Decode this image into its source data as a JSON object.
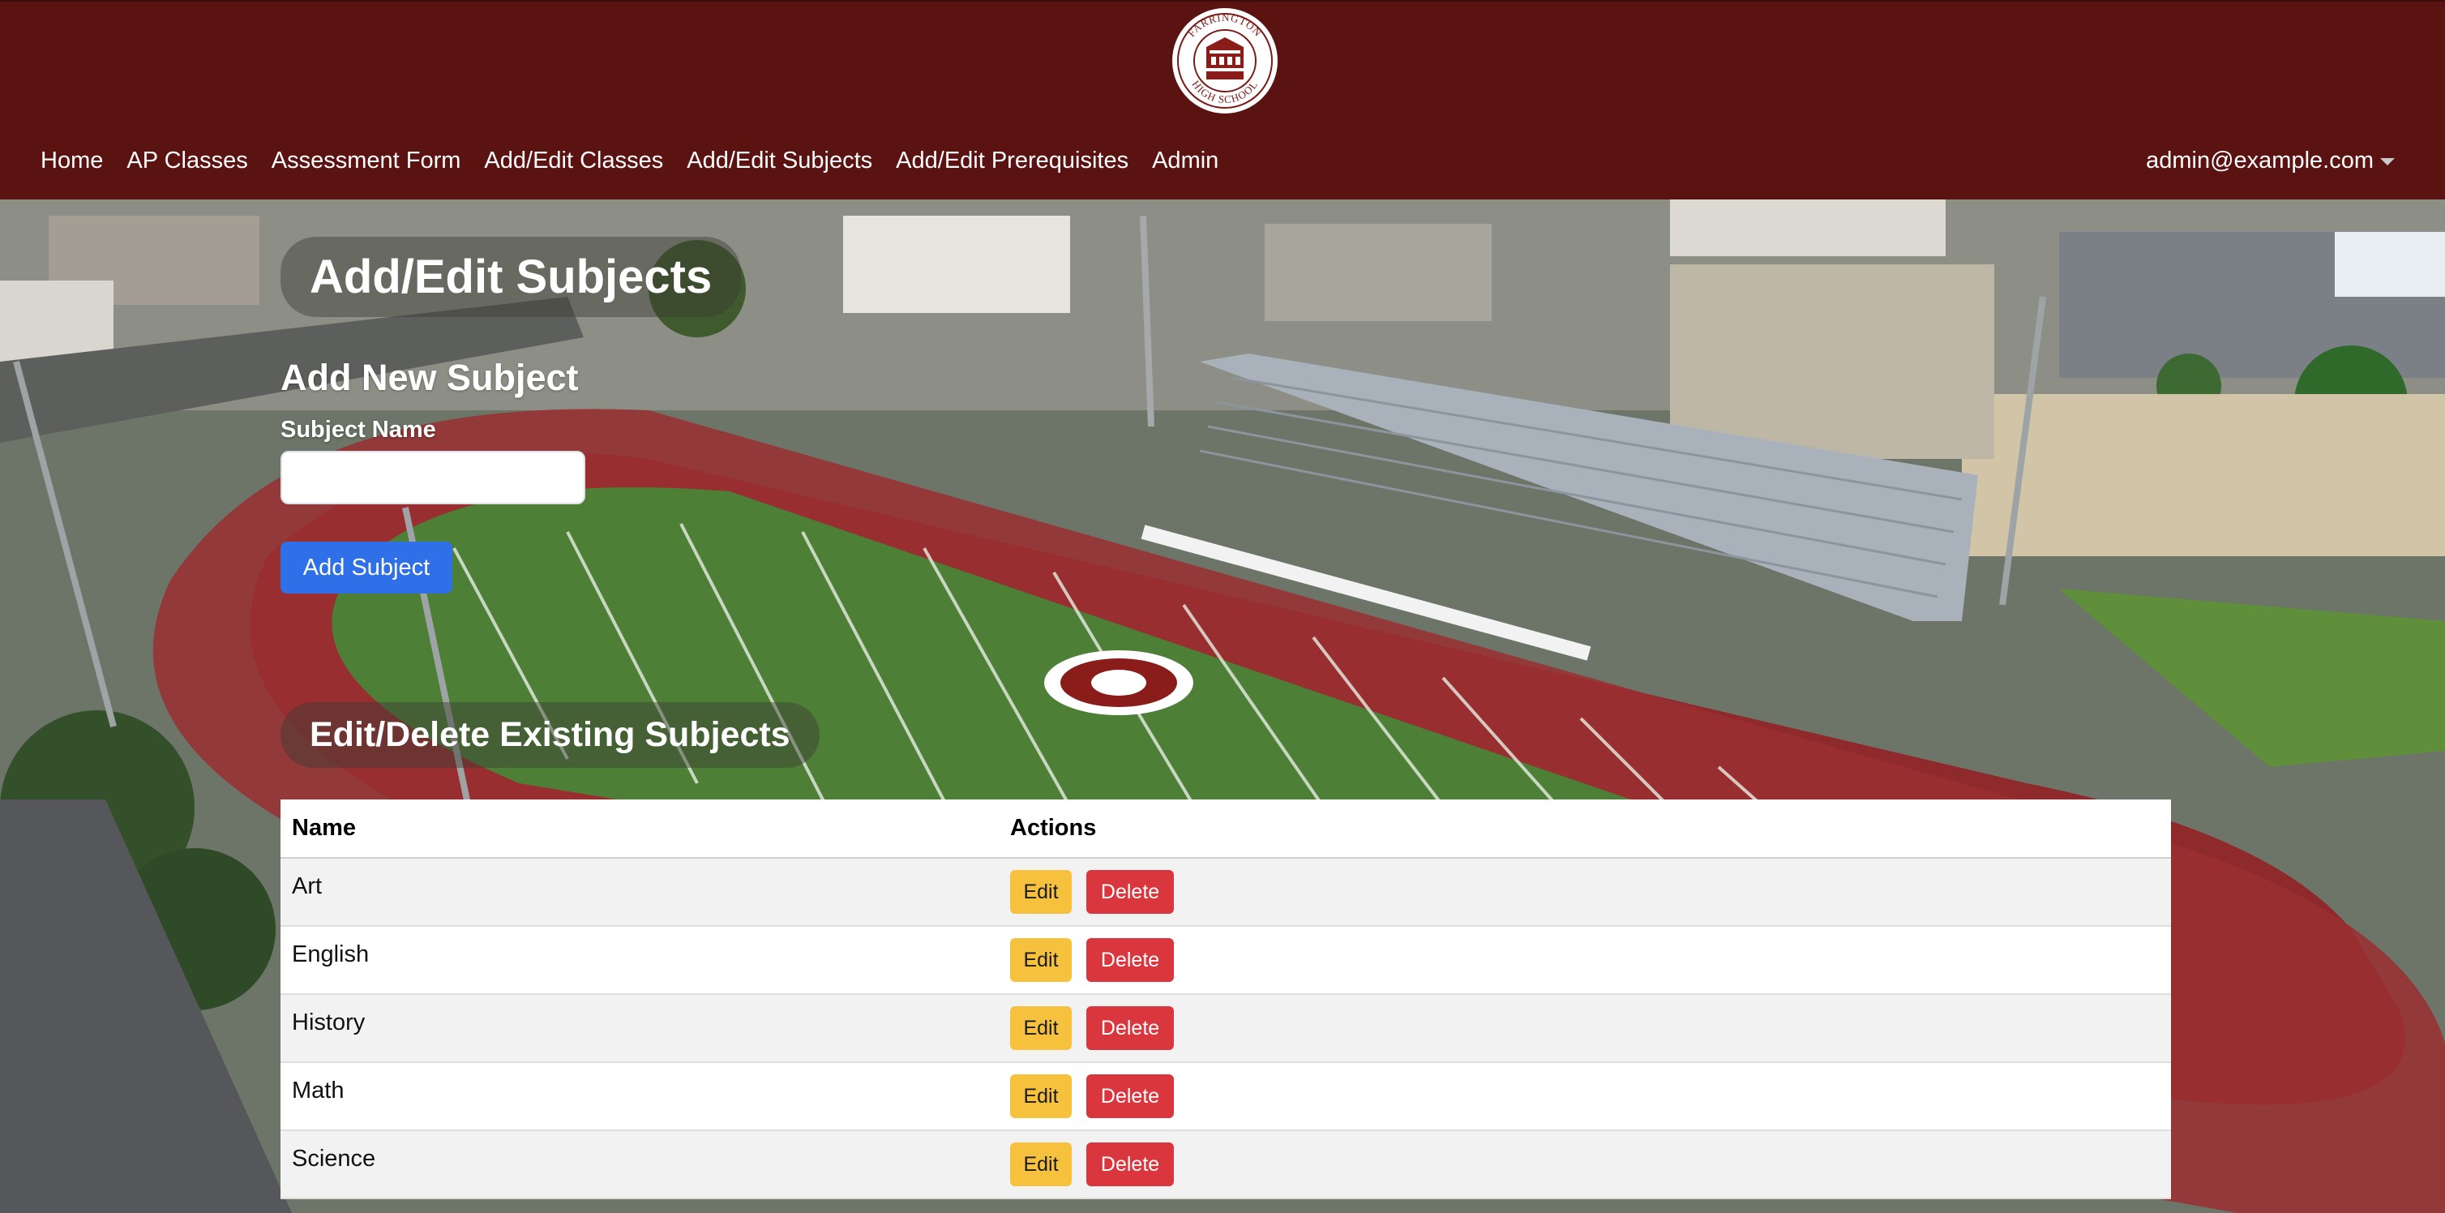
{
  "header": {
    "logo": {
      "icon": "farrington-high-school-seal-icon",
      "text_top": "FARRINGTON",
      "text_bottom": "HIGH SCHOOL"
    },
    "nav": [
      {
        "label": "Home"
      },
      {
        "label": "AP Classes"
      },
      {
        "label": "Assessment Form"
      },
      {
        "label": "Add/Edit Classes"
      },
      {
        "label": "Add/Edit Subjects"
      },
      {
        "label": "Add/Edit Prerequisites"
      },
      {
        "label": "Admin"
      }
    ],
    "user": {
      "email": "admin@example.com",
      "icon": "chevron-down-icon"
    }
  },
  "colors": {
    "header_bg": "#5b1311",
    "primary_button": "#2f6fe8",
    "edit_button": "#f6c23e",
    "delete_button": "#d9363e"
  },
  "page": {
    "title": "Add/Edit Subjects"
  },
  "add_form": {
    "title": "Add New Subject",
    "field_label": "Subject Name",
    "field_value": "",
    "submit_label": "Add Subject"
  },
  "existing": {
    "title": "Edit/Delete Existing Subjects",
    "columns": [
      "Name",
      "Actions"
    ],
    "rows": [
      {
        "name": "Art",
        "edit": "Edit",
        "delete": "Delete"
      },
      {
        "name": "English",
        "edit": "Edit",
        "delete": "Delete"
      },
      {
        "name": "History",
        "edit": "Edit",
        "delete": "Delete"
      },
      {
        "name": "Math",
        "edit": "Edit",
        "delete": "Delete"
      },
      {
        "name": "Science",
        "edit": "Edit",
        "delete": "Delete"
      }
    ]
  }
}
